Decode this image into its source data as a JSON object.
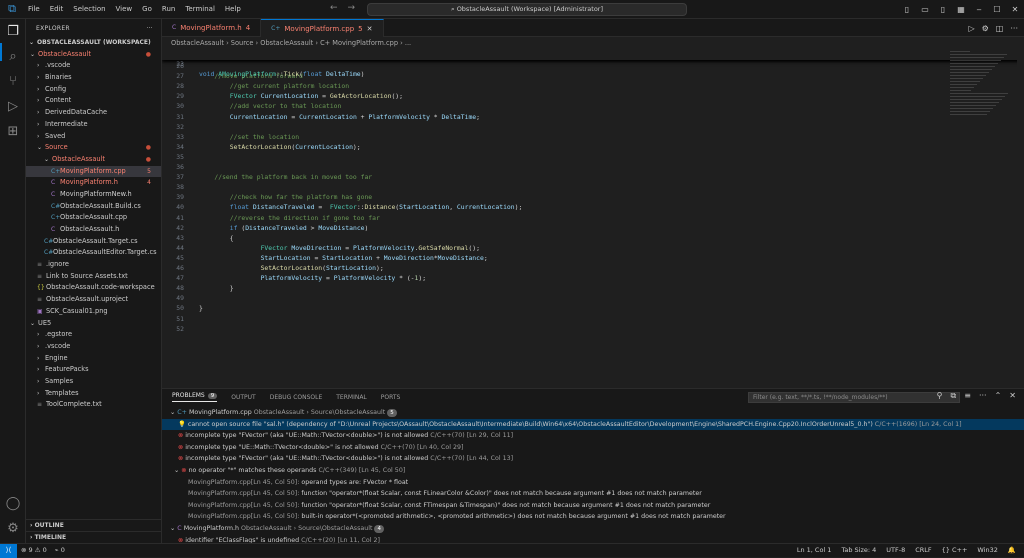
{
  "titlebar": {
    "menu": [
      "File",
      "Edit",
      "Selection",
      "View",
      "Go",
      "Run",
      "Terminal",
      "Help"
    ],
    "search": "ObstacleAssault (Workspace) [Administrator]"
  },
  "explorer": {
    "title": "EXPLORER",
    "workspace": "OBSTACLEASSAULT (WORKSPACE)",
    "items": [
      {
        "label": "ObstacleAssault",
        "indent": 0,
        "chev": "⌄",
        "red": true,
        "dot": true
      },
      {
        "label": ".vscode",
        "indent": 1,
        "chev": "›"
      },
      {
        "label": "Binaries",
        "indent": 1,
        "chev": "›"
      },
      {
        "label": "Config",
        "indent": 1,
        "chev": "›"
      },
      {
        "label": "Content",
        "indent": 1,
        "chev": "›"
      },
      {
        "label": "DerivedDataCache",
        "indent": 1,
        "chev": "›"
      },
      {
        "label": "Intermediate",
        "indent": 1,
        "chev": "›"
      },
      {
        "label": "Saved",
        "indent": 1,
        "chev": "›"
      },
      {
        "label": "Source",
        "indent": 1,
        "chev": "⌄",
        "red": true,
        "dot": true
      },
      {
        "label": "ObstacleAssault",
        "indent": 2,
        "chev": "⌄",
        "red": true,
        "dot": true
      },
      {
        "label": "MovingPlatform.cpp",
        "indent": 3,
        "icon": "C+",
        "red": true,
        "badge": "5",
        "sel": true
      },
      {
        "label": "MovingPlatform.h",
        "indent": 3,
        "icon": "C",
        "red": true,
        "badge": "4"
      },
      {
        "label": "MovingPlatformNew.h",
        "indent": 3,
        "icon": "C"
      },
      {
        "label": "ObstacleAssault.Build.cs",
        "indent": 3,
        "icon": "C#"
      },
      {
        "label": "ObstacleAssault.cpp",
        "indent": 3,
        "icon": "C+"
      },
      {
        "label": "ObstacleAssault.h",
        "indent": 3,
        "icon": "C"
      },
      {
        "label": "ObstacleAssault.Target.cs",
        "indent": 2,
        "icon": "C#"
      },
      {
        "label": "ObstacleAssaultEditor.Target.cs",
        "indent": 2,
        "icon": "C#"
      },
      {
        "label": ".ignore",
        "indent": 1,
        "icon": "≡"
      },
      {
        "label": "Link to Source Assets.txt",
        "indent": 1,
        "icon": "≡"
      },
      {
        "label": "ObstacleAssault.code-workspace",
        "indent": 1,
        "icon": "{}"
      },
      {
        "label": "ObstacleAssault.uproject",
        "indent": 1,
        "icon": "≡"
      },
      {
        "label": "SCK_Casual01.png",
        "indent": 1,
        "icon": "▣"
      },
      {
        "label": "UE5",
        "indent": 0,
        "chev": "⌄"
      },
      {
        "label": ".egstore",
        "indent": 1,
        "chev": "›"
      },
      {
        "label": ".vscode",
        "indent": 1,
        "chev": "›"
      },
      {
        "label": "Engine",
        "indent": 1,
        "chev": "›"
      },
      {
        "label": "FeaturePacks",
        "indent": 1,
        "chev": "›"
      },
      {
        "label": "Samples",
        "indent": 1,
        "chev": "›"
      },
      {
        "label": "Templates",
        "indent": 1,
        "chev": "›"
      },
      {
        "label": "ToolComplete.txt",
        "indent": 1,
        "icon": "≡"
      }
    ],
    "outline": "OUTLINE",
    "timeline": "TIMELINE"
  },
  "tabs": [
    {
      "label": "MovingPlatform.h",
      "count": "4",
      "active": false
    },
    {
      "label": "MovingPlatform.cpp",
      "count": "5",
      "active": true
    }
  ],
  "breadcrumb": "ObstacleAssault › Source › ObstacleAssault › C+ MovingPlatform.cpp › ...",
  "sticky": {
    "ln": "23",
    "code": "void AMovingPlatform::Tick(float DeltaTime)"
  },
  "code": [
    {
      "ln": "26",
      "html": ""
    },
    {
      "ln": "27",
      "html": "    <span class='cm'>//move platform forward</span>"
    },
    {
      "ln": "28",
      "html": "        <span class='cm'>//get current platform location</span>"
    },
    {
      "ln": "29",
      "html": "        <span class='ty'>FVector</span> <span class='vr'>CurrentLocation</span> <span class='pl'>=</span> <span class='fn'>GetActorLocation</span><span class='pl'>();</span>"
    },
    {
      "ln": "30",
      "html": "        <span class='cm'>//add vector to that location</span>"
    },
    {
      "ln": "31",
      "html": "        <span class='vr'>CurrentLocation</span> <span class='pl'>=</span> <span class='vr'>CurrentLocation</span> <span class='pl'>+</span> <span class='fld'>PlatformVelocity</span> <span class='pl'>*</span> <span class='vr'>DeltaTime</span><span class='pl'>;</span>"
    },
    {
      "ln": "32",
      "html": ""
    },
    {
      "ln": "33",
      "html": "        <span class='cm'>//set the location</span>"
    },
    {
      "ln": "34",
      "html": "        <span class='fn'>SetActorLocation</span><span class='pl'>(</span><span class='vr'>CurrentLocation</span><span class='pl'>);</span>"
    },
    {
      "ln": "35",
      "html": ""
    },
    {
      "ln": "36",
      "html": ""
    },
    {
      "ln": "37",
      "html": "    <span class='cm'>//send the platform back in moved too far</span>"
    },
    {
      "ln": "38",
      "html": ""
    },
    {
      "ln": "39",
      "html": "        <span class='cm'>//check how far the platform has gone</span>"
    },
    {
      "ln": "40",
      "html": "        <span class='kw'>float</span> <span class='vr'>DistanceTraveled</span> <span class='pl'>=</span>  <span class='ty'>FVector</span><span class='pl'>::</span><span class='fn'>Distance</span><span class='pl'>(</span><span class='fld'>StartLocation</span><span class='pl'>,</span> <span class='vr'>CurrentLocation</span><span class='pl'>);</span>"
    },
    {
      "ln": "41",
      "html": "        <span class='cm'>//reverse the direction if gone too far</span>"
    },
    {
      "ln": "42",
      "html": "        <span class='kw'>if</span> <span class='pl'>(</span><span class='vr'>DistanceTraveled</span> <span class='pl'>&gt;</span> <span class='fld'>MoveDistance</span><span class='pl'>)</span>"
    },
    {
      "ln": "43",
      "html": "        <span class='pl'>{</span>"
    },
    {
      "ln": "44",
      "html": "                <span class='ty'>FVector</span> <span class='vr'>MoveDirection</span> <span class='pl'>=</span> <span class='fld'>PlatformVelocity</span><span class='pl'>.</span><span class='fn'>GetSafeNormal</span><span class='pl'>();</span>"
    },
    {
      "ln": "45",
      "html": "                <span class='fld'>StartLocation</span> <span class='pl'>=</span> <span class='fld'>StartLocation</span> <span class='pl'>+</span> <span class='vr'>MoveDirection</span><span class='pl'>*</span><span class='fld'>MoveDistance</span><span class='pl'>;</span>"
    },
    {
      "ln": "46",
      "html": "                <span class='fn'>SetActorLocation</span><span class='pl'>(</span><span class='fld'>StartLocation</span><span class='pl'>);</span>"
    },
    {
      "ln": "47",
      "html": "                <span class='fld'>PlatformVelocity</span> <span class='pl'>=</span> <span class='fld'>PlatformVelocity</span> <span class='pl'>* (-</span><span class='nm'>1</span><span class='pl'>);</span>"
    },
    {
      "ln": "48",
      "html": "        <span class='pl'>}</span>"
    },
    {
      "ln": "49",
      "html": ""
    },
    {
      "ln": "50",
      "html": "<span class='pl'>}</span>"
    },
    {
      "ln": "51",
      "html": ""
    },
    {
      "ln": "52",
      "html": ""
    }
  ],
  "panel": {
    "tabs": [
      {
        "label": "PROBLEMS",
        "count": "9",
        "active": true
      },
      {
        "label": "OUTPUT"
      },
      {
        "label": "DEBUG CONSOLE"
      },
      {
        "label": "TERMINAL"
      },
      {
        "label": "PORTS"
      }
    ],
    "filter_placeholder": "Filter (e.g. text, **/*.ts, !**/node_modules/**)",
    "rows": [
      {
        "kind": "file",
        "html": "⌄ <span style='color:#519aba'>C+</span> MovingPlatform.cpp <span class='mut'>ObstacleAssault › Source\\ObstacleAssault</span> <span class='pcnt2'>5</span>"
      },
      {
        "kind": "info",
        "sel": true,
        "html": "&nbsp;&nbsp;&nbsp;&nbsp;<span style='color:#cca700'>💡</span> cannot open source file \"sal.h\" (dependency of \"D:\\Unreal Projects\\OAssault\\ObstacleAssault\\Intermediate\\Build\\Win64\\x64\\ObstacleAssaultEditor\\Development\\Engine\\SharedPCH.Engine.Cpp20.InclOrderUnreal5_0.h\") <span class='mut'>C/C++(1696) [Ln 24, Col 1]</span>"
      },
      {
        "kind": "err",
        "html": "&nbsp;&nbsp;&nbsp;&nbsp;<span class='err'>⊗</span> incomplete type \"FVector\" (aka \"UE::Math::TVector&lt;double&gt;\") is not allowed <span class='mut'>C/C++(70) [Ln 29, Col 11]</span>"
      },
      {
        "kind": "err",
        "html": "&nbsp;&nbsp;&nbsp;&nbsp;<span class='err'>⊗</span> incomplete type \"UE::Math::TVector&lt;double&gt;\" is not allowed <span class='mut'>C/C++(70) [Ln 40, Col 29]</span>"
      },
      {
        "kind": "err",
        "html": "&nbsp;&nbsp;&nbsp;&nbsp;<span class='err'>⊗</span> incomplete type \"FVector\" (aka \"UE::Math::TVector&lt;double&gt;\") is not allowed <span class='mut'>C/C++(70) [Ln 44, Col 13]</span>"
      },
      {
        "kind": "err",
        "html": "&nbsp;&nbsp;⌄ <span class='err'>⊗</span> no operator \"*\" matches these operands <span class='mut'>C/C++(349) [Ln 45, Col 50]</span>"
      },
      {
        "kind": "sub",
        "html": "&nbsp;&nbsp;&nbsp;&nbsp;&nbsp;&nbsp;&nbsp;&nbsp;&nbsp;<span class='mut'>MovingPlatform.cpp[Ln 45, Col 50]:</span> operand types are: FVector * float"
      },
      {
        "kind": "sub",
        "html": "&nbsp;&nbsp;&nbsp;&nbsp;&nbsp;&nbsp;&nbsp;&nbsp;&nbsp;<span class='mut'>MovingPlatform.cpp[Ln 45, Col 50]:</span> function \"operator*(float Scalar, const FLinearColor &amp;Color)\" does not match because argument #1 does not match parameter"
      },
      {
        "kind": "sub",
        "html": "&nbsp;&nbsp;&nbsp;&nbsp;&nbsp;&nbsp;&nbsp;&nbsp;&nbsp;<span class='mut'>MovingPlatform.cpp[Ln 45, Col 50]:</span> function \"operator*(float Scalar, const FTimespan &amp;Timespan)\" does not match because argument #1 does not match parameter"
      },
      {
        "kind": "sub",
        "html": "&nbsp;&nbsp;&nbsp;&nbsp;&nbsp;&nbsp;&nbsp;&nbsp;&nbsp;<span class='mut'>MovingPlatform.cpp[Ln 45, Col 50]:</span> built-in operator*(&lt;promoted arithmetic&gt;, &lt;promoted arithmetic&gt;) does not match because argument #1 does not match parameter"
      },
      {
        "kind": "file",
        "html": "⌄ <span style='color:#a074c4'>C</span> MovingPlatform.h <span class='mut'>ObstacleAssault › Source\\ObstacleAssault</span> <span class='pcnt2'>4</span>"
      },
      {
        "kind": "err",
        "html": "&nbsp;&nbsp;&nbsp;&nbsp;<span class='err'>⊗</span> identifier \"EClassFlags\" is undefined <span class='mut'>C/C++(20) [Ln 11, Col 2]</span>"
      }
    ]
  },
  "status": {
    "left": [
      "⊗ 9 ⚠ 0",
      "⌁ 0"
    ],
    "right": [
      "Ln 1, Col 1",
      "Tab Size: 4",
      "UTF-8",
      "CRLF",
      "{} C++",
      "Win32",
      "🔔"
    ]
  }
}
